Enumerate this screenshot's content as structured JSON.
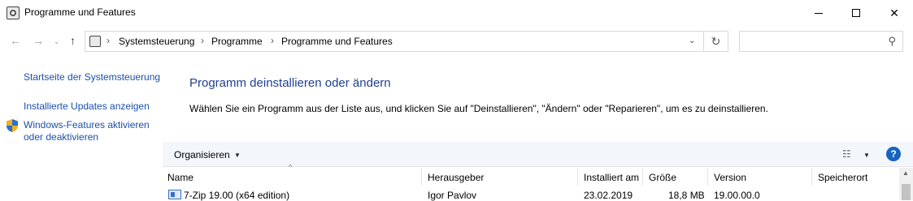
{
  "window": {
    "title": "Programme und Features",
    "minimize": "minimize",
    "maximize": "maximize",
    "close": "✕"
  },
  "nav": {
    "back": "←",
    "forward": "→",
    "history": "⌄",
    "up": "↑",
    "separator": "›",
    "breadcrumbs": [
      "Systemsteuerung",
      "Programme",
      "Programme und Features"
    ],
    "address_dropdown": "⌄",
    "refresh": "↻",
    "search_placeholder": "",
    "search_icon": "⚲"
  },
  "sidebar": {
    "links": [
      "Startseite der Systemsteuerung",
      "Installierte Updates anzeigen",
      "Windows-Features aktivieren",
      "oder deaktivieren"
    ]
  },
  "main": {
    "title": "Programm deinstallieren oder ändern",
    "description": "Wählen Sie ein Programm aus der Liste aus, und klicken Sie auf \"Deinstallieren\", \"Ändern\" oder \"Reparieren\", um es zu deinstallieren."
  },
  "toolbar": {
    "organize": "Organisieren",
    "caret": "▼",
    "view_icon": "☷",
    "help": "?"
  },
  "table": {
    "sort_indicator": "^",
    "columns": [
      "Name",
      "Herausgeber",
      "Installiert am",
      "Größe",
      "Version",
      "Speicherort"
    ],
    "rows": [
      {
        "name": "7-Zip 19.00 (x64 edition)",
        "publisher": "Igor Pavlov",
        "installed": "23.02.2019",
        "size": "18,8 MB",
        "version": "19.00.00.0",
        "location": ""
      }
    ]
  },
  "colors": {
    "link": "#1a4fa8",
    "title": "#1e3f8e",
    "toolbar_bg": "#f3f6fb",
    "help": "#1565c0"
  }
}
